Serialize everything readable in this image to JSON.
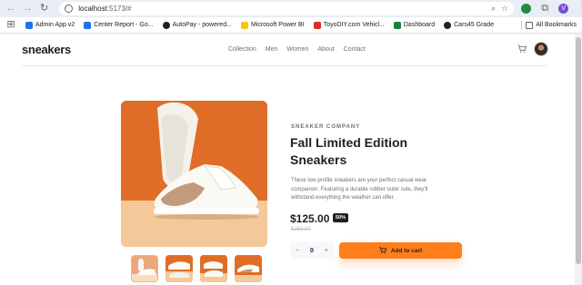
{
  "browser": {
    "url_host": "localhost",
    "url_path": ":5173/#",
    "profile_initial": "V",
    "bookmarks": [
      {
        "label": "Admin App v2",
        "color": "#1a73e8"
      },
      {
        "label": "Center Report - Go...",
        "color": "#1a73e8"
      },
      {
        "label": "AutoPay - powered...",
        "color": "#202124"
      },
      {
        "label": "Microsoft Power BI",
        "color": "#f2c811"
      },
      {
        "label": "ToyoDIY.com Vehicl...",
        "color": "#d93025"
      },
      {
        "label": "Dashboard",
        "color": "#188038"
      },
      {
        "label": "Cars45 Grade",
        "color": "#202124"
      }
    ],
    "all_bookmarks": "All Bookmarks"
  },
  "site": {
    "logo": "sneakers",
    "nav": [
      "Collection",
      "Men",
      "Women",
      "About",
      "Contact"
    ]
  },
  "product": {
    "company": "SNEAKER COMPANY",
    "title": "Fall Limited Edition Sneakers",
    "description": "These low-profile sneakers are your perfect casual wear companion. Featuring a durable rubber outer sole, they'll withstand everything the weather can offer.",
    "price": "$125.00",
    "discount": "50%",
    "original_price": "$250.00",
    "quantity": "0",
    "minus": "−",
    "plus": "+",
    "add_to_cart": "Add to cart"
  },
  "colors": {
    "accent": "#ff7e1b",
    "dark": "#1d2025",
    "grey": "#69707d"
  }
}
